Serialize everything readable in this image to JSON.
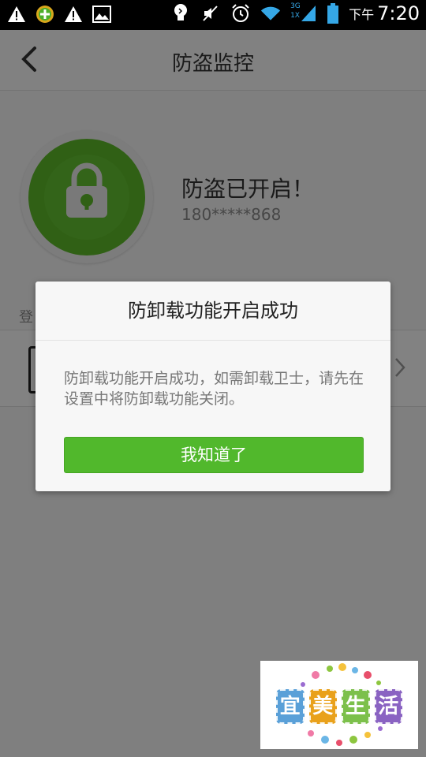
{
  "status_bar": {
    "ampm": "下午",
    "time": "7:20",
    "network_badge_top": "3G",
    "network_badge_bottom": "1X",
    "left_icons": [
      "warning-icon",
      "shield-plus-icon",
      "warning-icon",
      "image-icon"
    ],
    "right_icons": [
      "lightbulb-icon",
      "mute-icon",
      "alarm-icon",
      "wifi-icon",
      "signal-icon",
      "battery-icon"
    ]
  },
  "header": {
    "title": "防盗监控"
  },
  "main": {
    "status": "防盗已开启！",
    "phone": "180*****868",
    "device_section_label": "登",
    "device_row_icon": "phone-icon"
  },
  "dialog": {
    "title": "防卸载功能开启成功",
    "message": "防卸载功能开启成功，如需卸载卫士，请先在设置中将防卸载功能关闭。",
    "ok_button": "我知道了"
  },
  "watermark": {
    "chars": [
      "宜",
      "美",
      "生",
      "活"
    ],
    "colors": [
      "#5aa0d8",
      "#e9a11b",
      "#7cc04b",
      "#8a63c2"
    ]
  },
  "colors": {
    "accent_green": "#51b82c",
    "lock_green": "#5db82a"
  }
}
